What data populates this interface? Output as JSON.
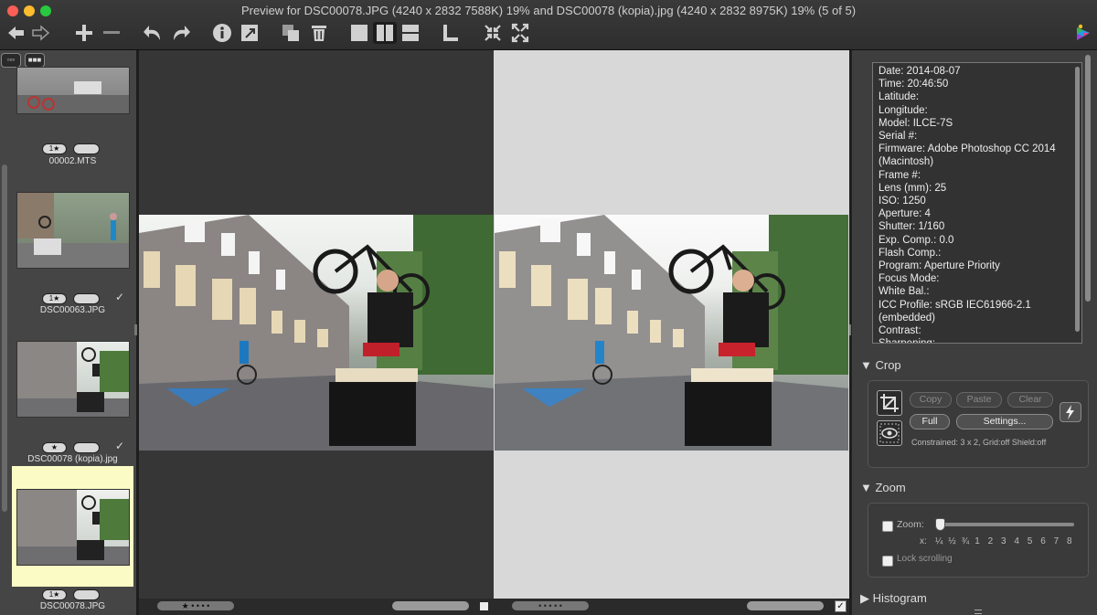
{
  "window": {
    "title": "Preview for DSC00078.JPG (4240 x 2832 7588K) 19% and DSC00078 (kopia).jpg (4240 x 2832 8975K) 19% (5 of 5)"
  },
  "toolbar": {
    "icons": [
      "back-arrow-icon",
      "forward-arrow-icon",
      "add-icon",
      "remove-icon",
      "undo-icon",
      "redo-icon",
      "info-icon",
      "export-icon",
      "duplicate-icon",
      "trash-icon",
      "single-view-icon",
      "side-by-side-icon",
      "stacked-view-icon",
      "align-icon",
      "fit-icon",
      "fullscreen-icon",
      "app-logo-icon"
    ]
  },
  "left_panel": {
    "view_buttons": [
      "grid-small",
      "grid-large"
    ],
    "thumbnails": [
      {
        "filename": "00002.MTS",
        "rating": "1★",
        "checked": false
      },
      {
        "filename": "DSC00063.JPG",
        "rating": "1★",
        "checked": true
      },
      {
        "filename": "DSC00078 (kopia).jpg",
        "rating": "★",
        "checked": true
      },
      {
        "filename": "DSC00078.JPG",
        "rating": "1★",
        "checked": false,
        "selected": true
      }
    ]
  },
  "viewer": {
    "left_rating": "★ • • • •",
    "right_rating": "• • • • •"
  },
  "inspector": {
    "exif": [
      "Date: 2014-08-07",
      "Time: 20:46:50",
      "Latitude:",
      "Longitude:",
      "Model: ILCE-7S",
      "Serial #:",
      "Firmware: Adobe Photoshop CC 2014",
      "(Macintosh)",
      "Frame #:",
      "Lens (mm): 25",
      "ISO: 1250",
      "Aperture: 4",
      "Shutter: 1/160",
      "Exp. Comp.: 0.0",
      "Flash Comp.:",
      "Program: Aperture Priority",
      "Focus Mode:",
      "White Bal.:",
      "ICC Profile: sRGB IEC61966-2.1",
      "(embedded)",
      "Contrast:",
      "Sharpening:"
    ],
    "crop": {
      "title": "Crop",
      "copy": "Copy",
      "paste": "Paste",
      "clear": "Clear",
      "full": "Full",
      "settings": "Settings...",
      "status": "Constrained: 3 x 2, Grid:off Shield:off"
    },
    "zoom": {
      "title": "Zoom",
      "label": "Zoom:",
      "x_label": "x:",
      "ticks": [
        "¼",
        "½",
        "¾",
        "1",
        "2",
        "3",
        "4",
        "5",
        "6",
        "7",
        "8"
      ],
      "lock": "Lock scrolling"
    },
    "histogram": {
      "title": "Histogram"
    }
  }
}
